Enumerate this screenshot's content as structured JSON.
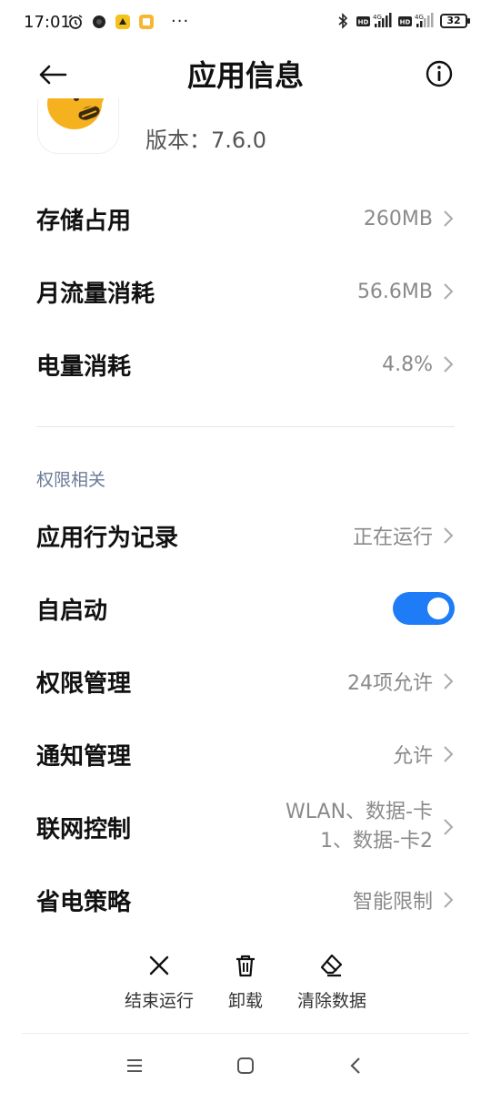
{
  "status_bar": {
    "time": "17:01",
    "battery": "32",
    "net1": "4G",
    "net2": "4G",
    "hd1": "HD",
    "hd2": "HD"
  },
  "header": {
    "title": "应用信息"
  },
  "app": {
    "version": "版本：7.6.0"
  },
  "rows_top": [
    {
      "label": "存储占用",
      "value": "260MB"
    },
    {
      "label": "月流量消耗",
      "value": "56.6MB"
    },
    {
      "label": "电量消耗",
      "value": "4.8%"
    }
  ],
  "section": {
    "title": "权限相关"
  },
  "rows_perm": [
    {
      "label": "应用行为记录",
      "value": "正在运行"
    },
    {
      "label": "自启动",
      "toggle_on": true
    },
    {
      "label": "权限管理",
      "value": "24项允许"
    },
    {
      "label": "通知管理",
      "value": "允许"
    },
    {
      "label": "联网控制",
      "value_line1": "WLAN、数据-卡",
      "value_line2": "1、数据-卡2"
    },
    {
      "label": "省电策略",
      "value": "智能限制"
    }
  ],
  "actions": [
    {
      "label": "结束运行",
      "icon": "close-icon"
    },
    {
      "label": "卸载",
      "icon": "trash-icon"
    },
    {
      "label": "清除数据",
      "icon": "eraser-icon"
    }
  ],
  "colors": {
    "accent": "#1e7cf6",
    "value_text": "#8a8a8a",
    "section_title": "#6b7b98"
  }
}
